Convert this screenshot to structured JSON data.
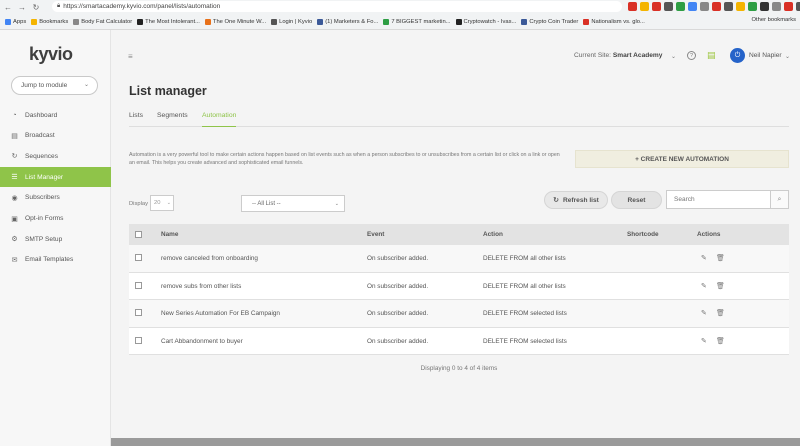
{
  "browser": {
    "url": "https://smartacademy.kyvio.com/panel/lists/automation",
    "bookmarks": [
      {
        "label": "Apps",
        "color": "#4285f4"
      },
      {
        "label": "Bookmarks",
        "color": "#f4b400"
      },
      {
        "label": "Body Fat Calculator",
        "color": "#888888"
      },
      {
        "label": "The Most Intolerant...",
        "color": "#222222"
      },
      {
        "label": "The One Minute W...",
        "color": "#e8711a"
      },
      {
        "label": "Login | Kyvio",
        "color": "#555555"
      },
      {
        "label": "(1) Marketers & Fo...",
        "color": "#3b5998"
      },
      {
        "label": "7 BIGGEST marketin...",
        "color": "#2e9e44"
      },
      {
        "label": "Cryptowatch - Ivas...",
        "color": "#222222"
      },
      {
        "label": "Crypto Coin Trader",
        "color": "#3b5998"
      },
      {
        "label": "Nationalism vs. glo...",
        "color": "#d93025"
      }
    ],
    "other_bookmarks": "Other bookmarks"
  },
  "sidebar": {
    "logo": "kyvio",
    "jump_label": "Jump to module",
    "items": [
      {
        "label": "Dashboard",
        "icon": "gauge-icon",
        "glyph": "◔"
      },
      {
        "label": "Broadcast",
        "icon": "inbox-icon",
        "glyph": "▤"
      },
      {
        "label": "Sequences",
        "icon": "refresh-icon",
        "glyph": "↻"
      },
      {
        "label": "List Manager",
        "icon": "list-icon",
        "glyph": "☰"
      },
      {
        "label": "Subscribers",
        "icon": "users-icon",
        "glyph": "◉"
      },
      {
        "label": "Opt-in Forms",
        "icon": "form-icon",
        "glyph": "▣"
      },
      {
        "label": "SMTP Setup",
        "icon": "gear-icon",
        "glyph": "⚙"
      },
      {
        "label": "Email Templates",
        "icon": "envelope-icon",
        "glyph": "✉"
      }
    ],
    "active_index": 3
  },
  "header": {
    "site_label": "Current Site:",
    "site_name": "Smart Academy",
    "user_name": "Neil Napier"
  },
  "page": {
    "title": "List manager",
    "tabs": [
      "Lists",
      "Segments",
      "Automation"
    ],
    "active_tab": 2,
    "description": "Automation is a very powerful tool to make certain actions happen based on list events such as when a person subscribes to or unsubscribes from a certain list or click on a link or open an email. This helps you create advanced and sophisticated email funnels.",
    "create_button": "+ CREATE NEW AUTOMATION",
    "display_label": "Display",
    "display_value": "20",
    "list_filter": "-- All List --",
    "refresh_label": "Refresh list",
    "reset_label": "Reset",
    "search_placeholder": "Search"
  },
  "table": {
    "columns": [
      "Name",
      "Event",
      "Action",
      "Shortcode",
      "Actions"
    ],
    "rows": [
      {
        "name": "remove canceled from onboarding",
        "event": "On subscriber added.",
        "action": "DELETE FROM all other lists",
        "shortcode": ""
      },
      {
        "name": "remove subs from other lists",
        "event": "On subscriber added.",
        "action": "DELETE FROM all other lists",
        "shortcode": ""
      },
      {
        "name": "New Series Automation For EB Campaign",
        "event": "On subscriber added.",
        "action": "DELETE FROM selected lists",
        "shortcode": ""
      },
      {
        "name": "Cart Abbandonment to buyer",
        "event": "On subscriber added.",
        "action": "DELETE FROM selected lists",
        "shortcode": ""
      }
    ],
    "paging": "Displaying 0 to 4 of 4 items"
  },
  "colors": {
    "accent": "#8fc449",
    "create_button_bg": "#f0eee0",
    "avatar": "#2563c9"
  }
}
